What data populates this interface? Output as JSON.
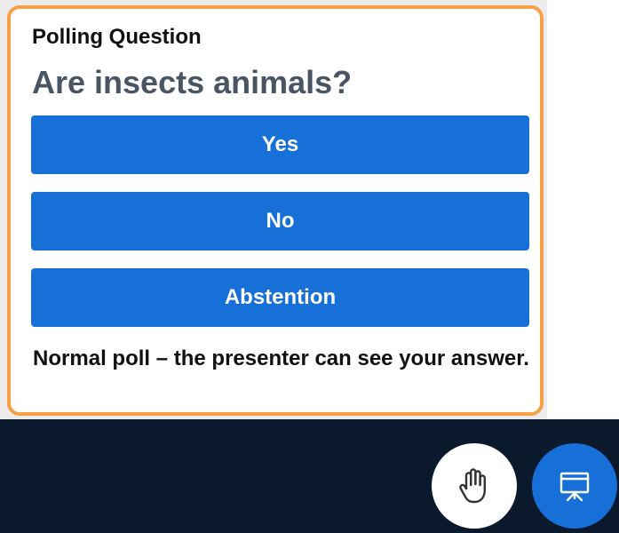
{
  "poll": {
    "label": "Polling Question",
    "question": "Are insects animals?",
    "options": [
      {
        "label": "Yes"
      },
      {
        "label": "No"
      },
      {
        "label": "Abstention"
      }
    ],
    "note": "Normal poll – the presenter can see your answer."
  },
  "controls": {
    "raise_hand_icon": "raise-hand-icon",
    "presentation_icon": "presentation-screen-icon"
  },
  "colors": {
    "panel_border": "#f7a046",
    "button_blue": "#1670d8",
    "question_text": "#4a5563",
    "dark_background": "#0a192c"
  }
}
